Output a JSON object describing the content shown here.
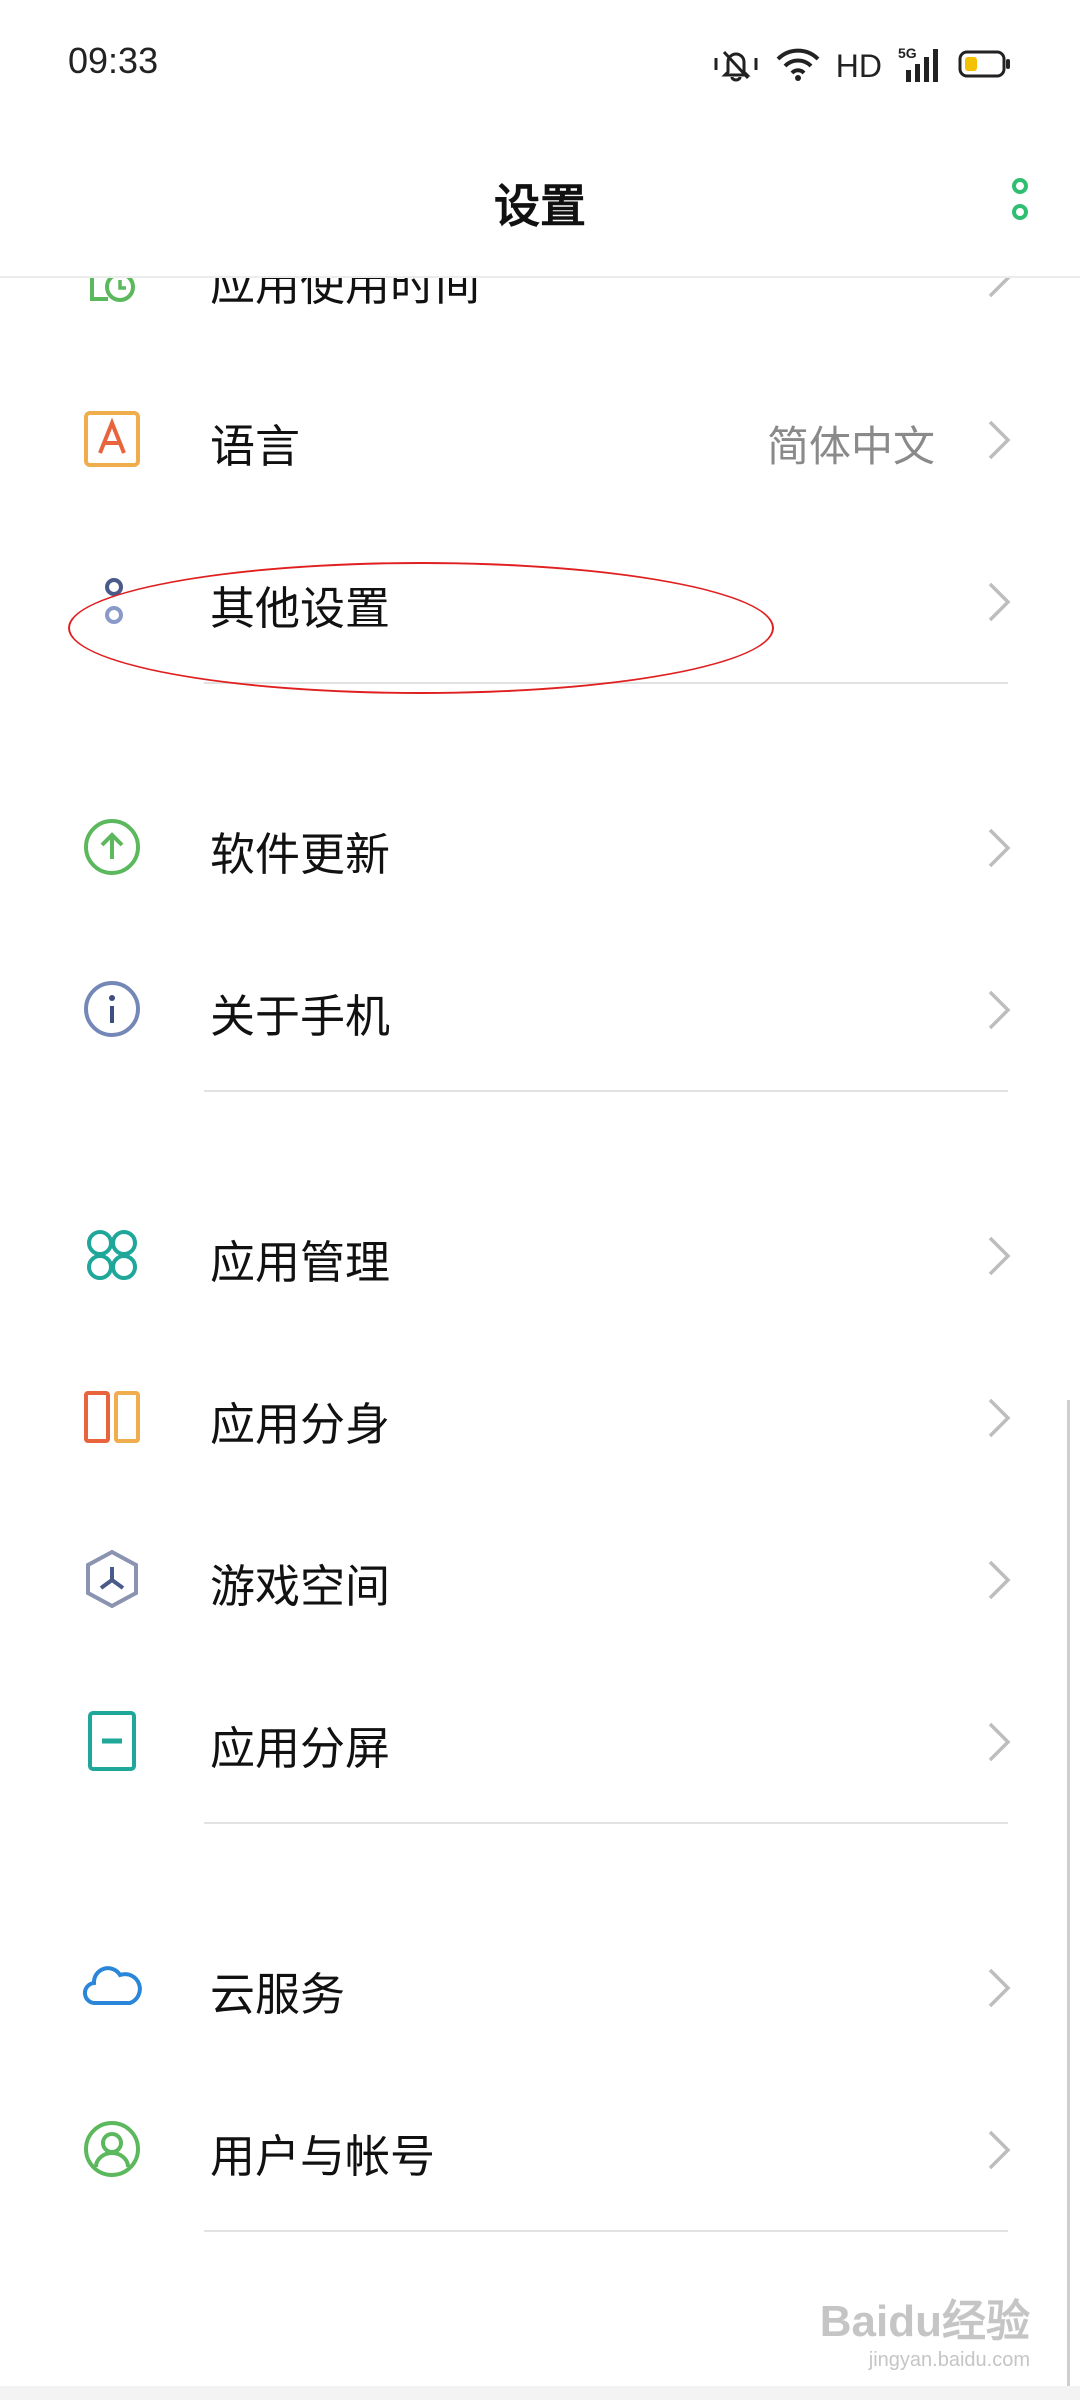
{
  "status_bar": {
    "time": "09:33",
    "hd": "HD",
    "network": "5G",
    "icons": [
      "mute-vibrate-icon",
      "wifi-icon",
      "signal-icon",
      "battery-icon"
    ]
  },
  "header": {
    "title": "设置",
    "more_icon": "more-vertical-icon",
    "accent_color": "#2fbf71"
  },
  "sections": [
    {
      "items": [
        {
          "label": "应用使用时间",
          "icon": "screen-time-icon",
          "value": ""
        },
        {
          "label": "语言",
          "icon": "language-icon",
          "value": "简体中文"
        },
        {
          "label": "其他设置",
          "icon": "other-settings-icon",
          "value": ""
        }
      ]
    },
    {
      "items": [
        {
          "label": "软件更新",
          "icon": "software-update-icon",
          "value": ""
        },
        {
          "label": "关于手机",
          "icon": "about-phone-icon",
          "value": ""
        }
      ]
    },
    {
      "items": [
        {
          "label": "应用管理",
          "icon": "app-management-icon",
          "value": ""
        },
        {
          "label": "应用分身",
          "icon": "app-clone-icon",
          "value": ""
        },
        {
          "label": "游戏空间",
          "icon": "game-space-icon",
          "value": ""
        },
        {
          "label": "应用分屏",
          "icon": "split-screen-icon",
          "value": ""
        }
      ]
    },
    {
      "items": [
        {
          "label": "云服务",
          "icon": "cloud-service-icon",
          "value": ""
        },
        {
          "label": "用户与帐号",
          "icon": "user-account-icon",
          "value": ""
        }
      ]
    }
  ],
  "annotation": {
    "color": "#e02020"
  },
  "watermark": {
    "main": "Baidu经验",
    "sub": "jingyan.baidu.com"
  }
}
